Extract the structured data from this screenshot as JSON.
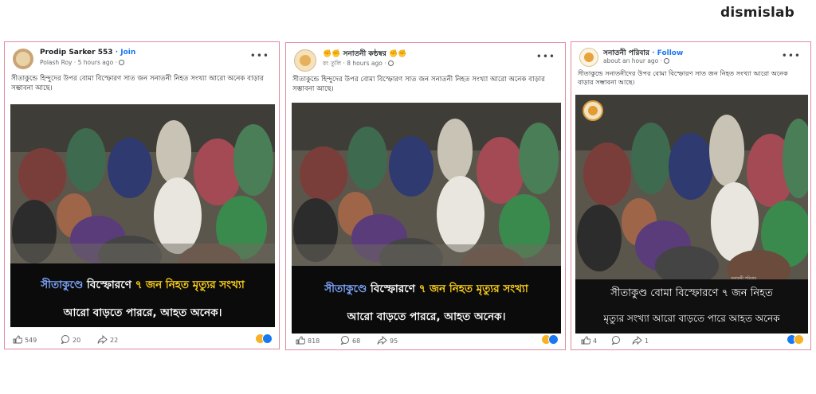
{
  "brand": {
    "logo_text": "dismislab"
  },
  "posts": [
    {
      "author": "Prodip Sarker 553",
      "join": "· Join",
      "subline": "Polash Roy · 5 hours ago ·",
      "caption": "সীতাকুন্ডে হিন্দুদের উপর বোমা বিস্ফোরণ সাত জন সনাতনী নিহত সংখ্যা আরো অনেক বাড়ার সম্ভাবনা আছে।",
      "overlay_1a": "সীতাকুণ্ডে",
      "overlay_1b": " বিস্ফোরণে ",
      "overlay_1c": "৭ জন নিহত মৃত্যুর সংখ্যা",
      "overlay_2": "আরো বাড়তে পাররে, আহত অনেক।",
      "likes": "549",
      "comments": "20",
      "shares": "22"
    },
    {
      "author": "✊✊ সনাতনী কন্ঠস্বর ✊✊",
      "join": "",
      "subline": "রং তুলি · 8 hours ago ·",
      "caption": "সীতাকুন্ডে হিন্দুদের উপর বোমা বিস্ফোরণ সাত জন সনাতনী নিহত সংখ্যা আরো অনেক বাড়ার সম্ভাবনা আছে।",
      "overlay_1a": "সীতাকুণ্ডে",
      "overlay_1b": " বিস্ফোরণে ",
      "overlay_1c": "৭ জন নিহত মৃত্যুর সংখ্যা",
      "overlay_2": "আরো বাড়তে পাররে, আহত অনেক।",
      "likes": "818",
      "comments": "68",
      "shares": "95"
    },
    {
      "author": "সনাতনী পরিবার",
      "join": "· Follow",
      "subline": "about an hour ago ·",
      "caption": "সীতাকুন্ডে সনাতনীদের উপর বোমা বিস্ফোরণ সাত জন নিহত সংখ্যা আরো অনেক বাড়ার সম্ভাবনা আছে।",
      "overlay_1": "সীতাকুণ্ড বোমা বিস্ফোরণে ৭ জন নিহত",
      "overlay_2": "মৃত্যুর সংখ্যা আরো বাড়তে পারে আহত   অনেক",
      "watermark": "সনাতনী পরিবার",
      "likes": "4",
      "comments": "",
      "shares": "1"
    }
  ],
  "colors": {
    "card_border": "#e08aa0",
    "link_blue": "#1877f2",
    "overlay_bg": "#0b0b0b",
    "overlay_blue": "#7fa6ff",
    "overlay_yellow": "#ffd21a"
  },
  "icons": [
    "like-icon",
    "comment-icon",
    "share-icon",
    "globe-icon",
    "more-dots-icon",
    "reaction-icons"
  ]
}
